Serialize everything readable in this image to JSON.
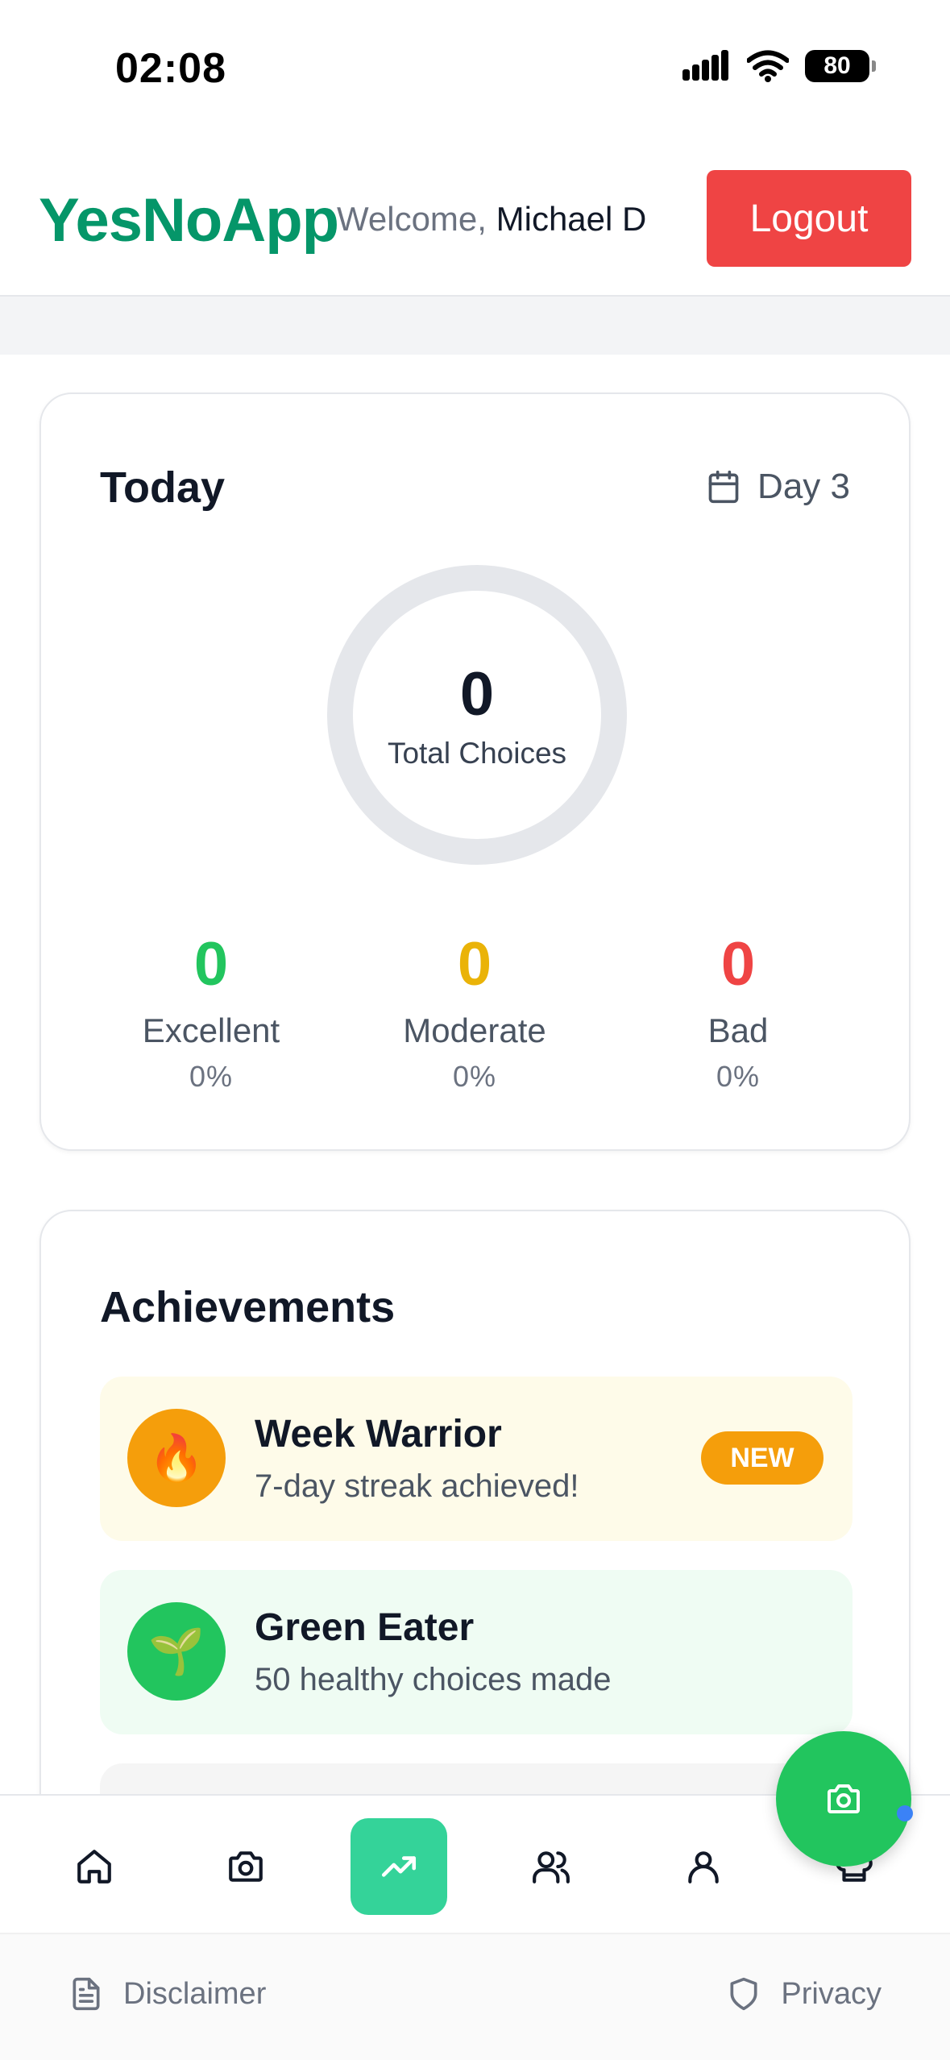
{
  "status_bar": {
    "time": "02:08",
    "battery": "80"
  },
  "header": {
    "brand": "YesNoApp",
    "welcome_prefix": "Welcome,",
    "user_name": "Michael D",
    "logout_label": "Logout"
  },
  "today": {
    "title": "Today",
    "day_label": "Day 3",
    "total_value": "0",
    "total_label": "Total Choices",
    "stats": [
      {
        "value": "0",
        "label": "Excellent",
        "percent": "0%",
        "color": "#22c55e"
      },
      {
        "value": "0",
        "label": "Moderate",
        "percent": "0%",
        "color": "#eab308"
      },
      {
        "value": "0",
        "label": "Bad",
        "percent": "0%",
        "color": "#ef4444"
      }
    ]
  },
  "achievements": {
    "title": "Achievements",
    "items": [
      {
        "name": "Week Warrior",
        "description": "7-day streak achieved!",
        "emoji": "🔥",
        "tag": "NEW",
        "badge_color": "#f59e0b"
      },
      {
        "name": "Green Eater",
        "description": "50 healthy choices made",
        "emoji": "🌱",
        "badge_color": "#22c55e"
      }
    ]
  },
  "bottom_nav": {
    "items": [
      "home-icon",
      "camera-icon",
      "trending-up-icon",
      "users-icon",
      "user-icon",
      "chef-hat-icon"
    ],
    "active": "trending-up-icon"
  },
  "fab": {
    "icon": "camera-icon"
  },
  "footer": {
    "disclaimer_label": "Disclaimer",
    "privacy_label": "Privacy"
  }
}
